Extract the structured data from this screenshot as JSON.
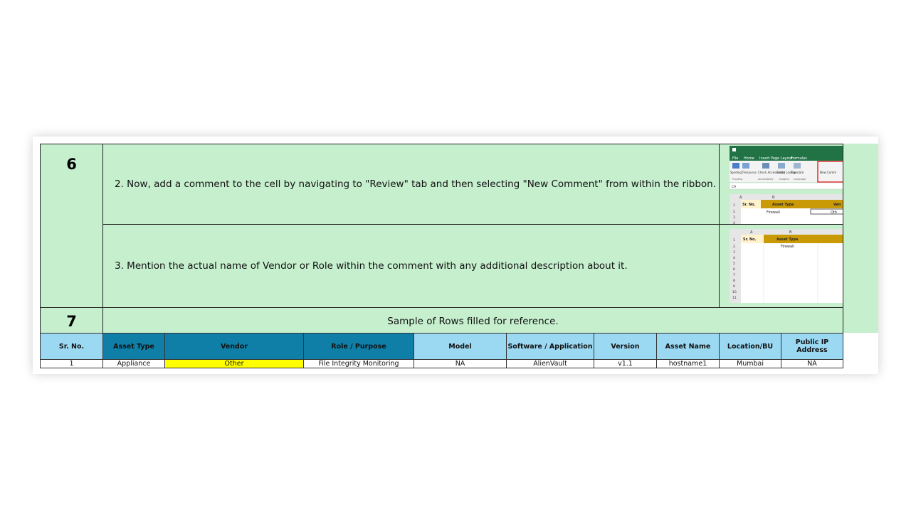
{
  "steps": {
    "step6_number": "6",
    "step6_line2": "2. Now, add a comment to the cell by navigating to \"Review\" tab and then selecting \"New Comment\" from within the ribbon.",
    "step6_line3": "3. Mention the actual name of Vendor or Role within the comment with any additional description about it.",
    "step7_number": "7",
    "step7_text": "Sample of Rows filled for reference."
  },
  "excel_thumb1": {
    "ribbon_tabs": [
      "File",
      "Home",
      "Insert",
      "Page Layout",
      "Formulas"
    ],
    "ribbon_buttons": [
      "Spelling",
      "Thesaurus",
      "Check Accessibility",
      "Smart Lookup",
      "Translate",
      "New Comm"
    ],
    "groups": [
      "Proofing",
      "Accessibility",
      "Insights",
      "Language"
    ],
    "name_box": "C9",
    "col_headers": [
      "A",
      "B"
    ],
    "header_cells": [
      "Sr. No.",
      "Asset Type",
      "Ven"
    ],
    "row_values": [
      "Firewall",
      "Oth"
    ],
    "row_numbers": [
      "1",
      "2",
      "3",
      "4"
    ]
  },
  "excel_thumb2": {
    "col_headers": [
      "A",
      "B"
    ],
    "header_cells": [
      "Sr. No.",
      "Asset Type"
    ],
    "row_values": [
      "Firewall"
    ],
    "row_numbers": [
      "1",
      "2",
      "3",
      "4",
      "5",
      "6",
      "7",
      "8",
      "9",
      "10",
      "11"
    ]
  },
  "table": {
    "headers": [
      "Sr. No.",
      "Asset Type",
      "Vendor",
      "Role / Purpose",
      "Model",
      "Software / Application",
      "Version",
      "Asset Name",
      "Location/BU",
      "Public IP Address"
    ],
    "row": [
      "1",
      "Appliance",
      "Other",
      "File Integrity Monitoring",
      "NA",
      "AlienVault",
      "v1.1",
      "hostname1",
      "Mumbai",
      "NA"
    ]
  },
  "colors": {
    "step_bg": "#c6efce",
    "header_light": "#9bd9f3",
    "header_dark": "#0f7fa8",
    "highlight": "#ffff00",
    "excel_green": "#217346",
    "excel_header_gold": "#c99a06"
  }
}
